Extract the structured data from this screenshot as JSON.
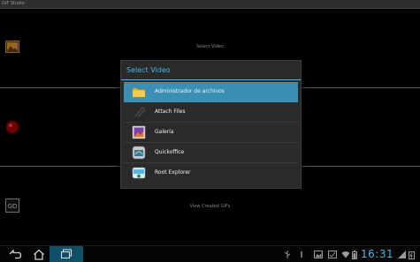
{
  "app": {
    "title": "GIF Studio"
  },
  "rows": [
    {
      "label": "Select Video",
      "icon": "film-icon"
    },
    {
      "label": "",
      "icon": "record-icon"
    },
    {
      "label": "View Created GIFs",
      "icon": "gd-logo-icon"
    }
  ],
  "dialog": {
    "title": "Select Video",
    "options": [
      {
        "label": "Administrador de archivos",
        "icon": "folder-icon",
        "selected": true
      },
      {
        "label": "Attach Files",
        "icon": "paperclip-icon",
        "selected": false
      },
      {
        "label": "Galería",
        "icon": "gallery-icon",
        "selected": false
      },
      {
        "label": "Quickoffice",
        "icon": "quickoffice-icon",
        "selected": false
      },
      {
        "label": "Root Explorer",
        "icon": "root-explorer-icon",
        "selected": false
      }
    ]
  },
  "navbar": {
    "clock": "16:31",
    "colors": {
      "accent": "#45b8e5",
      "recent_bg": "#0f4f68"
    }
  }
}
